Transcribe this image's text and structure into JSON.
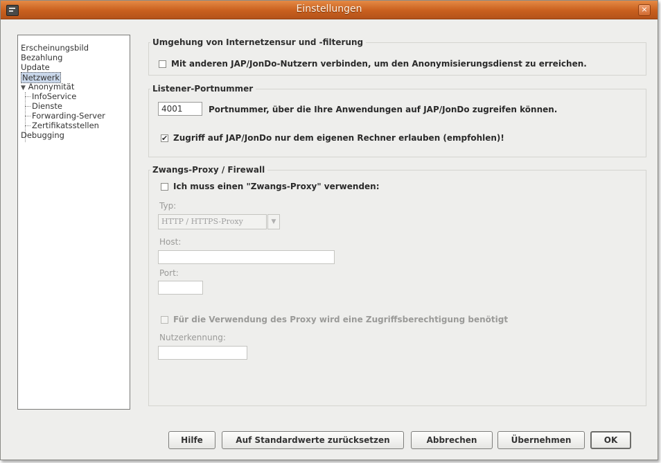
{
  "window": {
    "title": "Einstellungen",
    "close_glyph": "×"
  },
  "nav": {
    "items": [
      {
        "label": "Erscheinungsbild"
      },
      {
        "label": "Bezahlung"
      },
      {
        "label": "Update"
      },
      {
        "label": "Netzwerk",
        "selected": true
      },
      {
        "label": "Anonymität",
        "expander": "▼"
      },
      {
        "label": "InfoService"
      },
      {
        "label": "Dienste"
      },
      {
        "label": "Forwarding-Server"
      },
      {
        "label": "Zertifikatsstellen"
      },
      {
        "label": "Debugging"
      }
    ]
  },
  "censorship": {
    "title": "Umgehung von Internetzensur und -filterung",
    "connect_label": "Mit anderen JAP/JonDo-Nutzern verbinden, um den Anonymisierungsdienst zu erreichen.",
    "connect_checked": false
  },
  "listener": {
    "title": "Listener-Portnummer",
    "port_value": "4001",
    "port_desc": "Portnummer, über die Ihre Anwendungen auf JAP/JonDo zugreifen können.",
    "local_only_label": "Zugriff auf JAP/JonDo nur dem eigenen Rechner erlauben (empfohlen)!",
    "local_only_checked": true,
    "check_glyph": "✔"
  },
  "proxy": {
    "title": "Zwangs-Proxy / Firewall",
    "use_proxy_label": "Ich muss einen \"Zwangs-Proxy\" verwenden:",
    "use_proxy_checked": false,
    "type_label": "Typ:",
    "type_value": "HTTP / HTTPS-Proxy",
    "dropdown_glyph": "▼",
    "host_label": "Host:",
    "host_value": "",
    "port_label": "Port:",
    "port_value": "",
    "auth_label": "Für die Verwendung des Proxy wird eine Zugriffsberechtigung benötigt",
    "auth_checked": false,
    "user_label": "Nutzerkennung:",
    "user_value": ""
  },
  "buttons": {
    "help": "Hilfe",
    "reset": "Auf Standardwerte zurücksetzen",
    "cancel": "Abbrechen",
    "apply": "Übernehmen",
    "ok": "OK"
  }
}
